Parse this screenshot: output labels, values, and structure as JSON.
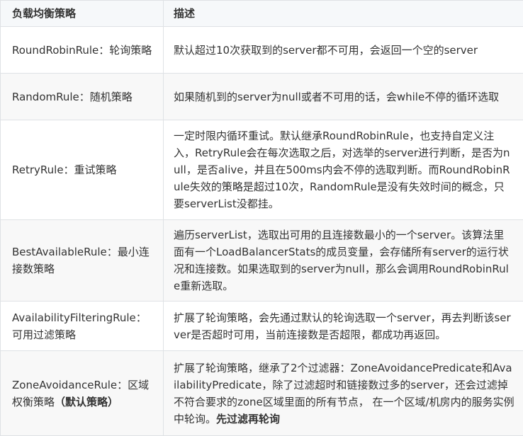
{
  "table": {
    "headers": [
      "负载均衡策略",
      "描述"
    ],
    "rows": [
      {
        "name": "RoundRobinRule：轮询策略",
        "name_suffix": "",
        "desc": "默认超过10次获取到的server都不可用，会返回一个空的server",
        "desc_suffix": ""
      },
      {
        "name": "RandomRule：随机策略",
        "name_suffix": "",
        "desc": "如果随机到的server为null或者不可用的话，会while不停的循环选取",
        "desc_suffix": ""
      },
      {
        "name": "RetryRule：重试策略",
        "name_suffix": "",
        "desc": "一定时限内循环重试。默认继承RoundRobinRule，也支持自定义注入，RetryRule会在每次选取之后，对选举的server进行判断，是否为null，是否alive，并且在500ms内会不停的选取判断。而RoundRobinRule失效的策略是超过10次，RandomRule是没有失效时间的概念，只要serverList没都挂。",
        "desc_suffix": ""
      },
      {
        "name": "BestAvailableRule：最小连接数策略",
        "name_suffix": "",
        "desc": "遍历serverList，选取出可用的且连接数最小的一个server。该算法里面有一个LoadBalancerStats的成员变量，会存储所有server的运行状况和连接数。如果选取到的server为null，那么会调用RoundRobinRule重新选取。",
        "desc_suffix": ""
      },
      {
        "name": "AvailabilityFilteringRule：可用过滤策略",
        "name_suffix": "",
        "desc": "扩展了轮询策略，会先通过默认的轮询选取一个server，再去判断该server是否超时可用，当前连接数是否超限，都成功再返回。",
        "desc_suffix": ""
      },
      {
        "name": "ZoneAvoidanceRule：区域权衡策略",
        "name_suffix": "（默认策略）",
        "desc": "扩展了轮询策略，继承了2个过滤器：ZoneAvoidancePredicate和AvailabilityPredicate，除了过滤超时和链接数过多的server，还会过滤掉不符合要求的zone区域里面的所有节点， 在一个区域/机房内的服务实例中轮询。",
        "desc_suffix": "先过滤再轮询"
      }
    ]
  }
}
